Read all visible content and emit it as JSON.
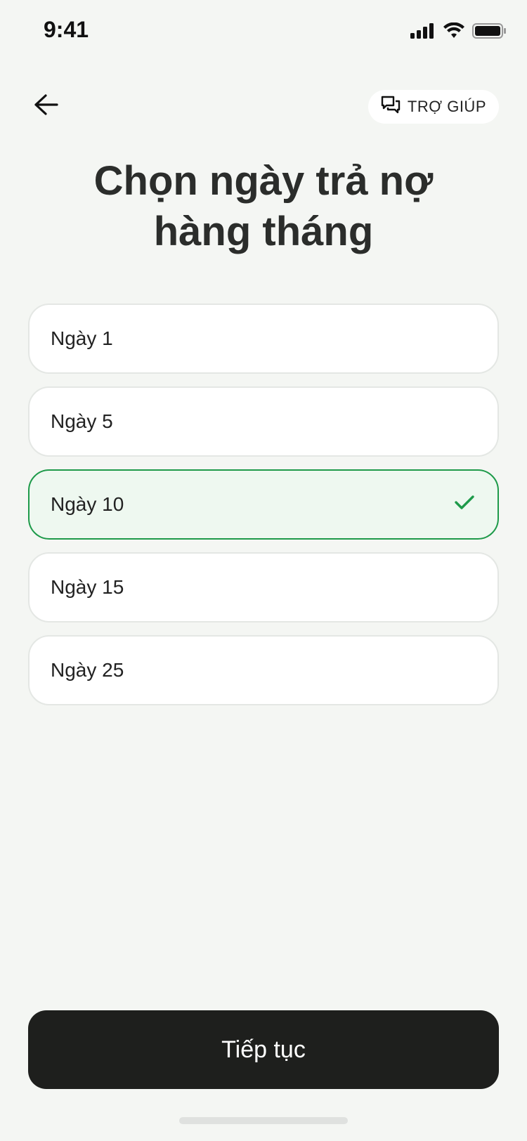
{
  "status_bar": {
    "time": "9:41",
    "icons": [
      "signal-icon",
      "wifi-icon",
      "battery-icon"
    ]
  },
  "header": {
    "back_icon": "arrow-left-icon",
    "help_label": "TRỢ GIÚP",
    "help_icon": "chat-bubbles-icon"
  },
  "title": {
    "line1": "Chọn ngày trả nợ",
    "line2": "hàng tháng"
  },
  "options": [
    {
      "label": "Ngày 1",
      "selected": false
    },
    {
      "label": "Ngày 5",
      "selected": false
    },
    {
      "label": "Ngày 10",
      "selected": true
    },
    {
      "label": "Ngày 15",
      "selected": false
    },
    {
      "label": "Ngày 25",
      "selected": false
    }
  ],
  "cta": {
    "label": "Tiếp tục"
  },
  "colors": {
    "background": "#f4f6f3",
    "selected_border": "#1e9a4a",
    "selected_fill": "#eef8f0",
    "cta_background": "#1e1f1d"
  }
}
